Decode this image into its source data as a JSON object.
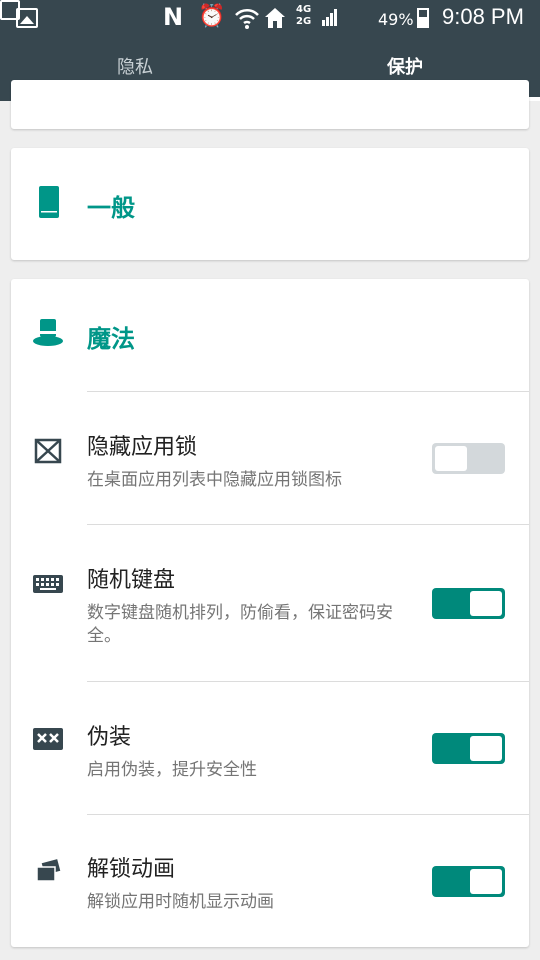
{
  "status_bar": {
    "network_label": "4G\n2G",
    "battery_percent": "49%",
    "time": "9:08 PM",
    "icons": [
      "gallery-icon",
      "nfc-icon",
      "alarm-icon",
      "wifi-icon",
      "home-icon",
      "signal-icon",
      "sim-icon",
      "battery-icon"
    ]
  },
  "tabs": [
    {
      "label": "隐私",
      "selected": false
    },
    {
      "label": "保护",
      "selected": true
    }
  ],
  "sections": {
    "general": {
      "title": "一般",
      "icon": "phone-icon"
    },
    "magic": {
      "title": "魔法",
      "icon": "magic-hat-icon",
      "items": [
        {
          "title": "隐藏应用锁",
          "description": "在桌面应用列表中隐藏应用锁图标",
          "icon": "hide-box-icon",
          "enabled": false
        },
        {
          "title": "随机键盘",
          "description": "数字键盘随机排列，防偷看，保证密码安全。",
          "icon": "keyboard-icon",
          "enabled": true
        },
        {
          "title": "伪装",
          "description": "启用伪装，提升安全性",
          "icon": "mask-icon",
          "enabled": true
        },
        {
          "title": "解锁动画",
          "description": "解锁应用时随机显示动画",
          "icon": "animation-cards-icon",
          "enabled": true
        }
      ]
    }
  },
  "colors": {
    "appbar": "#37474f",
    "accent": "#009688",
    "toggle_on": "#00897b",
    "toggle_off": "#d3d8db"
  }
}
